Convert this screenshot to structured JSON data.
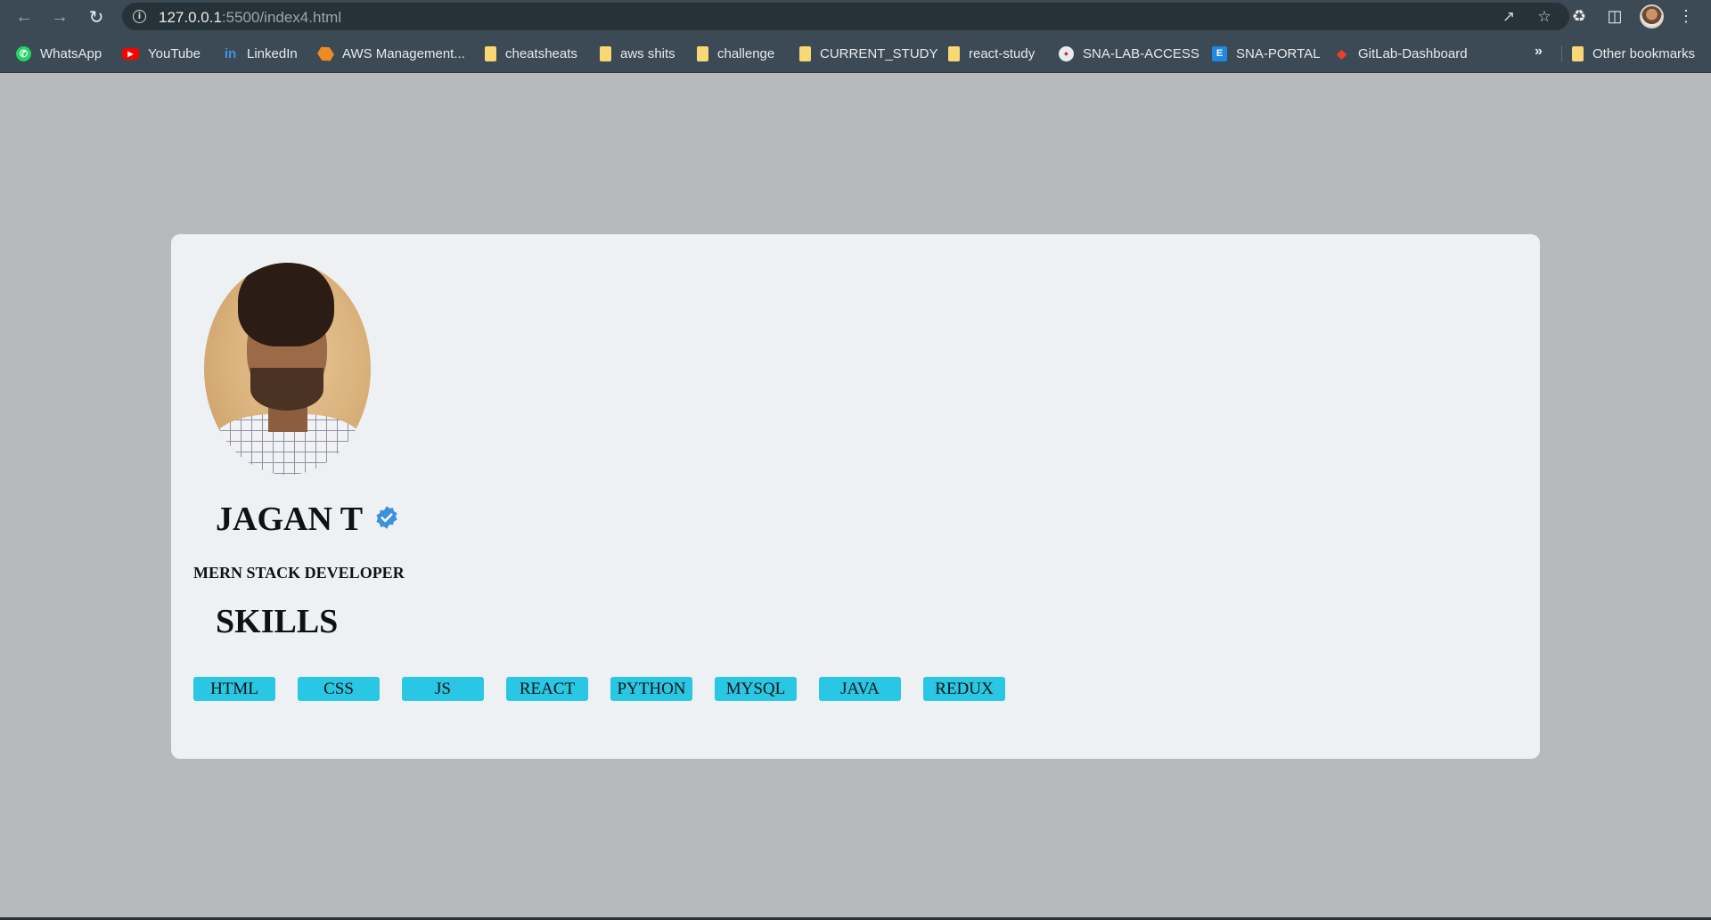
{
  "browser": {
    "url_host": "127.0.0.1",
    "url_rest": ":5500/index4.html",
    "bookmarks": [
      {
        "label": "WhatsApp",
        "icon": "whatsapp-icon"
      },
      {
        "label": "YouTube",
        "icon": "youtube-icon"
      },
      {
        "label": "LinkedIn",
        "icon": "linkedin-icon"
      },
      {
        "label": "AWS Management...",
        "icon": "aws-icon"
      },
      {
        "label": "cheatsheats",
        "icon": "folder-icon"
      },
      {
        "label": "aws shits",
        "icon": "folder-icon"
      },
      {
        "label": "challenge",
        "icon": "folder-icon"
      },
      {
        "label": "CURRENT_STUDY",
        "icon": "folder-icon"
      },
      {
        "label": "react-study",
        "icon": "folder-icon"
      },
      {
        "label": "SNA-LAB-ACCESS",
        "icon": "sna-icon"
      },
      {
        "label": "SNA-PORTAL",
        "icon": "portal-icon"
      },
      {
        "label": "GitLab-Dashboard",
        "icon": "gitlab-icon"
      }
    ],
    "overflow": "»",
    "other_bookmarks": "Other bookmarks"
  },
  "profile": {
    "name": "JAGAN T",
    "role": "MERN STACK DEVELOPER",
    "skills_title": "SKILLS",
    "skills": [
      "HTML",
      "CSS",
      "JS",
      "REACT",
      "PYTHON",
      "MYSQL",
      "JAVA",
      "REDUX"
    ],
    "verified_color": "#3d8fe0",
    "skill_color": "#29c7e3"
  }
}
